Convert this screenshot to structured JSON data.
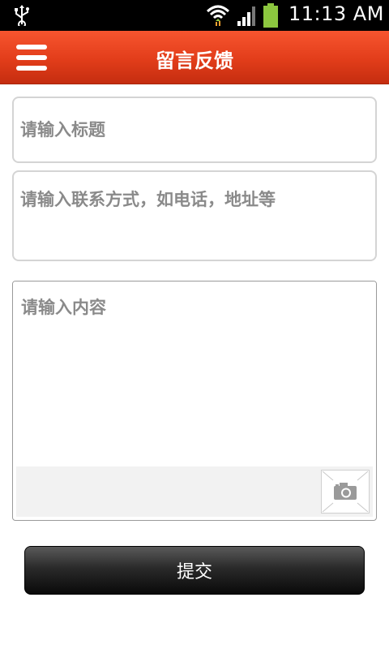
{
  "status_bar": {
    "time": "11:13 AM",
    "icons": [
      "usb-icon",
      "wifi-icon",
      "signal-icon",
      "battery-icon"
    ],
    "battery_color": "#8cc63f"
  },
  "header": {
    "title": "留言反馈",
    "menu_icon": "hamburger-menu-icon",
    "accent_color": "#e23d1a"
  },
  "form": {
    "title_placeholder": "请输入标题",
    "contact_placeholder": "请输入联系方式，如电话，地址等",
    "content_placeholder": "请输入内容",
    "attach_icon": "camera-icon",
    "submit_label": "提交"
  }
}
